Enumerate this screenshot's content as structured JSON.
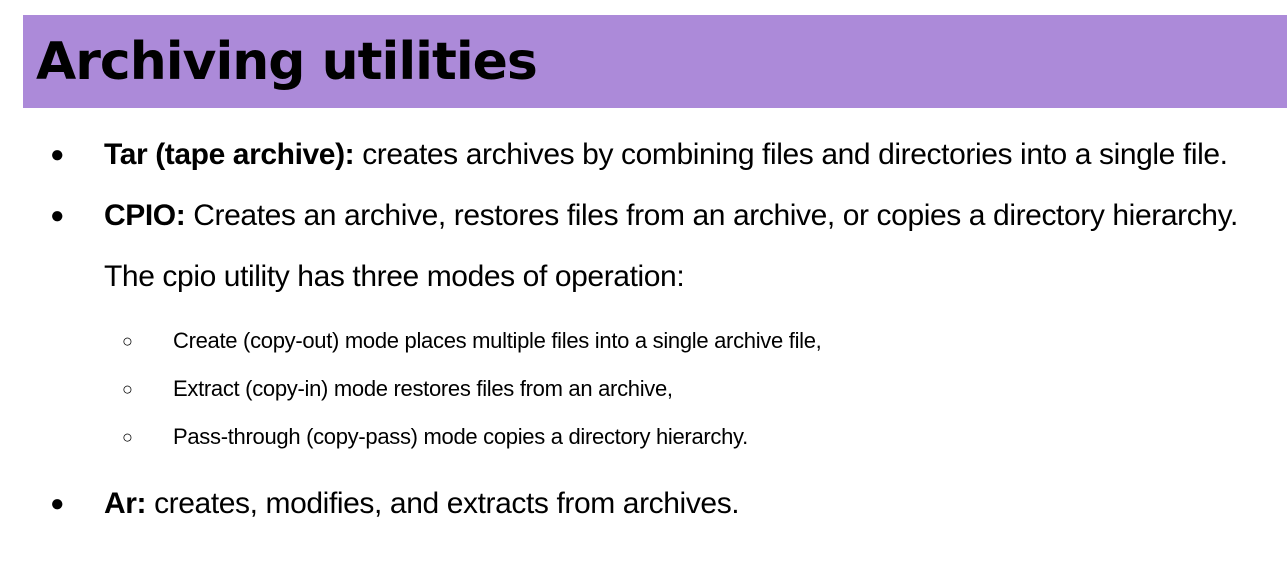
{
  "slide": {
    "title": "Archiving utilities",
    "title_bar_color": "#ac8ad9"
  },
  "items": [
    {
      "bullet": "●",
      "term": "Tar (tape archive):",
      "text": " creates archives by combining files and directories into a single file."
    },
    {
      "bullet": "●",
      "term": "CPIO:",
      "text": " Creates an archive, restores files from an archive, or copies a directory hierarchy. The cpio utility has three modes of operation:",
      "subitems": [
        {
          "bullet": "○",
          "text": "Create (copy-out) mode places multiple files into a single archive file,"
        },
        {
          "bullet": "○",
          "text": "Extract (copy-in) mode restores files from an archive,"
        },
        {
          "bullet": "○",
          "text": "Pass-through (copy-pass) mode copies a directory hierarchy."
        }
      ]
    },
    {
      "bullet": "●",
      "term": "Ar:",
      "text": " creates, modifies, and extracts from archives."
    }
  ]
}
